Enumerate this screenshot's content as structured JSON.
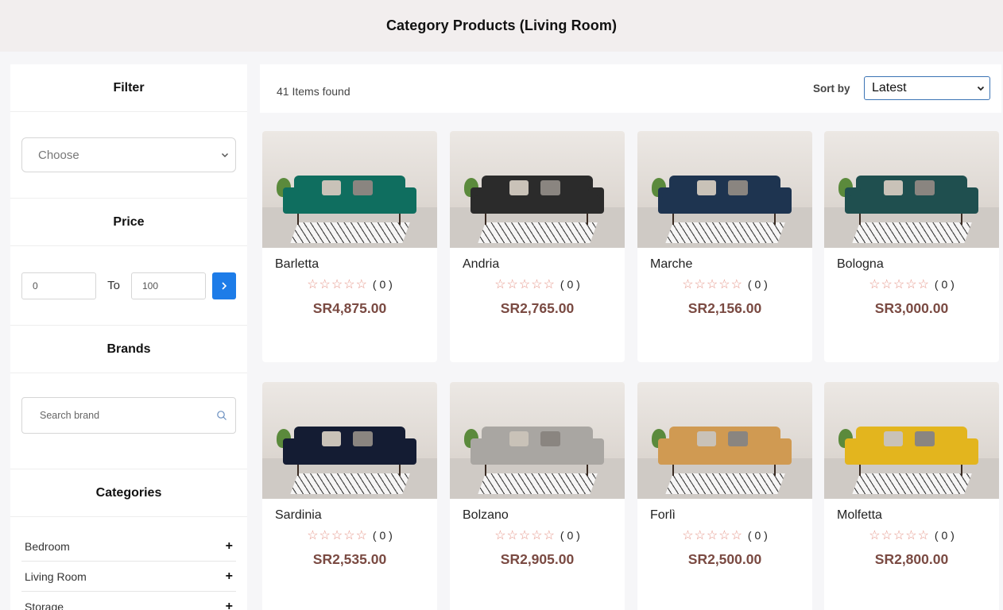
{
  "header": {
    "title": "Category Products (Living Room)"
  },
  "sidebar": {
    "filter": {
      "title": "Filter",
      "select_value": "Choose",
      "select_icon": "chevron-down-icon"
    },
    "price": {
      "title": "Price",
      "min_value": "0",
      "to_label": "To",
      "max_value": "100",
      "go_icon": "chevron-right-icon"
    },
    "brands": {
      "title": "Brands",
      "search_placeholder": "Search brand",
      "search_icon": "search-icon"
    },
    "categories": {
      "title": "Categories",
      "items": [
        {
          "label": "Bedroom",
          "icon": "plus-icon"
        },
        {
          "label": "Living Room",
          "icon": "plus-icon"
        },
        {
          "label": "Storage",
          "icon": "plus-icon"
        }
      ]
    }
  },
  "results": {
    "count_text": "41 Items found",
    "sort_label": "Sort by",
    "sort_value": "Latest"
  },
  "colors": {
    "accent": "#1d7ce8",
    "price": "#7a4a42",
    "star": "#e5968a",
    "header_bg": "#f2eeee"
  },
  "products": [
    {
      "name": "Barletta",
      "stars": "☆☆☆☆☆",
      "reviews": "( 0 )",
      "price": "SR4,875.00",
      "sofa_color": "#0f6e5f"
    },
    {
      "name": "Andria",
      "stars": "☆☆☆☆☆",
      "reviews": "( 0 )",
      "price": "SR2,765.00",
      "sofa_color": "#2b2b2b"
    },
    {
      "name": "Marche",
      "stars": "☆☆☆☆☆",
      "reviews": "( 0 )",
      "price": "SR2,156.00",
      "sofa_color": "#1e3450"
    },
    {
      "name": "Bologna",
      "stars": "☆☆☆☆☆",
      "reviews": "( 0 )",
      "price": "SR3,000.00",
      "sofa_color": "#1f4f4f"
    },
    {
      "name": "Sardinia",
      "stars": "☆☆☆☆☆",
      "reviews": "( 0 )",
      "price": "SR2,535.00",
      "sofa_color": "#141c33"
    },
    {
      "name": "Bolzano",
      "stars": "☆☆☆☆☆",
      "reviews": "( 0 )",
      "price": "SR2,905.00",
      "sofa_color": "#a9a6a2"
    },
    {
      "name": "Forlì",
      "stars": "☆☆☆☆☆",
      "reviews": "( 0 )",
      "price": "SR2,500.00",
      "sofa_color": "#d09a52"
    },
    {
      "name": "Molfetta",
      "stars": "☆☆☆☆☆",
      "reviews": "( 0 )",
      "price": "SR2,800.00",
      "sofa_color": "#e3b51e"
    }
  ]
}
